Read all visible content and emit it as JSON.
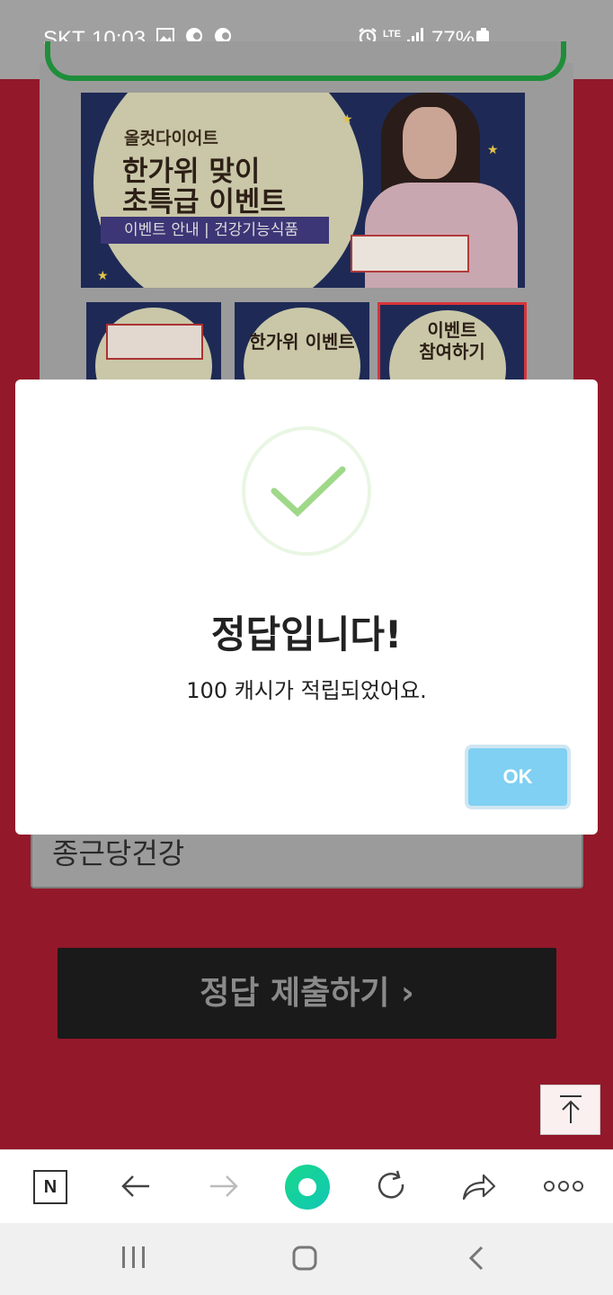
{
  "status_bar": {
    "carrier": "SKT",
    "time": "10:03",
    "network": "LTE",
    "battery": "77%"
  },
  "banner": {
    "brand": "올컷다이어트",
    "title_line1": "한가위 맞이",
    "title_line2": "초특급 이벤트",
    "tag": "이벤트 안내  |  건강기능식품"
  },
  "thumbnails": [
    {
      "label": ""
    },
    {
      "label": "한가위 이벤트"
    },
    {
      "label": "이벤트\n참여하기"
    }
  ],
  "quiz": {
    "answer_value": "종근당건강",
    "submit_label": "정답 제출하기 ›"
  },
  "dialog": {
    "title": "정답입니다!",
    "message": "100 캐시가 적립되었어요.",
    "ok_label": "OK"
  },
  "colors": {
    "page_bg": "#93182a",
    "ok_button": "#7fd0f2",
    "check_green": "#9fd889"
  },
  "toolbar": {
    "home_icon": "N",
    "icons": [
      "naver-home-icon",
      "back-arrow-icon",
      "forward-arrow-icon",
      "green-dot-icon",
      "refresh-icon",
      "share-icon",
      "more-icon"
    ]
  }
}
